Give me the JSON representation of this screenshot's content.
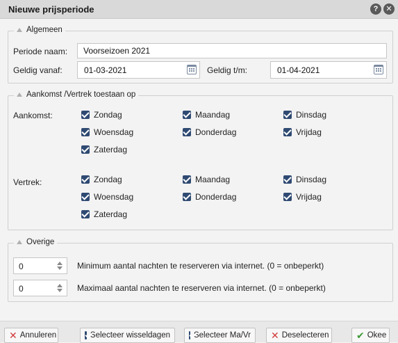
{
  "dialog": {
    "title": "Nieuwe prijsperiode",
    "help_label": "?",
    "close_label": "✕"
  },
  "algemeen": {
    "legend": "Algemeen",
    "periode_label": "Periode naam:",
    "periode_value": "Voorseizoen 2021",
    "vanaf_label": "Geldig vanaf:",
    "vanaf_value": "01-03-2021",
    "tm_label": "Geldig t/m:",
    "tm_value": "01-04-2021"
  },
  "aankomst_vertrek": {
    "legend": "Aankomst /Vertrek toestaan op",
    "aankomst_label": "Aankomst:",
    "vertrek_label": "Vertrek:",
    "days": [
      "Zondag",
      "Maandag",
      "Dinsdag",
      "Woensdag",
      "Donderdag",
      "Vrijdag",
      "Zaterdag"
    ],
    "aankomst_checked": [
      true,
      true,
      true,
      true,
      true,
      true,
      true
    ],
    "vertrek_checked": [
      true,
      true,
      true,
      true,
      true,
      true,
      true
    ]
  },
  "overige": {
    "legend": "Overige",
    "min_value": "0",
    "min_label": "Minimum aantal nachten te reserveren via internet. (0 = onbeperkt)",
    "max_value": "0",
    "max_label": "Maximaal aantal nachten te reserveren via internet. (0 = onbeperkt)"
  },
  "footer": {
    "annuleren": "Annuleren",
    "selecteer_wisseldagen": "Selecteer wisseldagen",
    "selecteer_mavr": "Selecteer Ma/Vr",
    "deselecteren": "Deselecteren",
    "okee": "Okee"
  },
  "colors": {
    "accent_checkbox": "#2f4a72",
    "cancel_x": "#d23b3b",
    "ok_check": "#3c9a35"
  }
}
